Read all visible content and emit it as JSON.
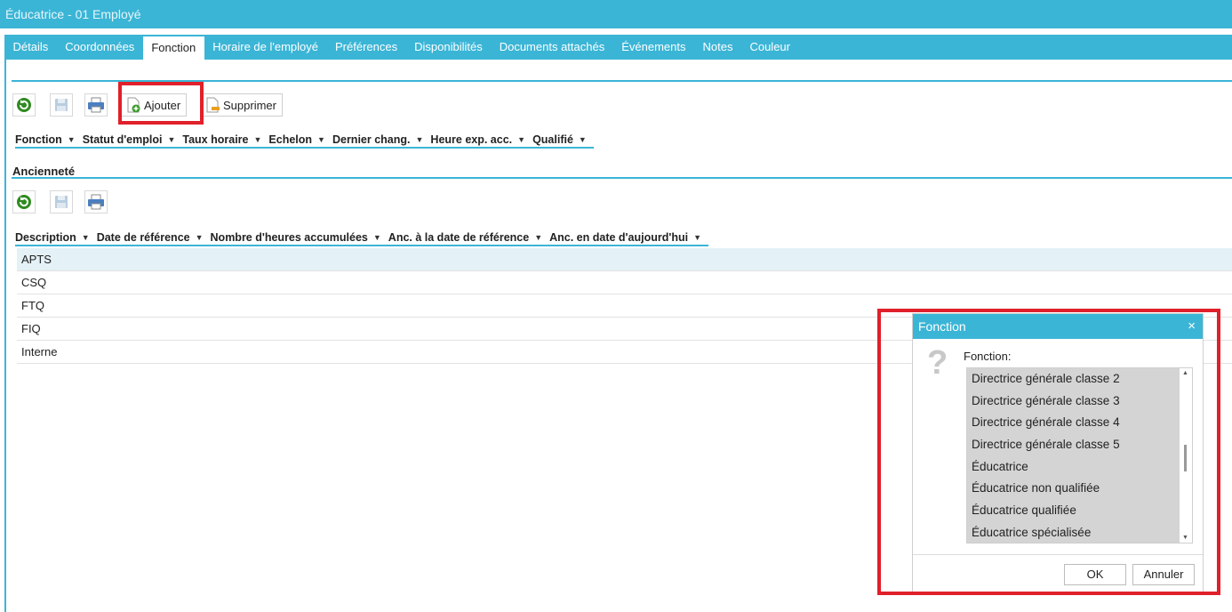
{
  "window": {
    "title": "Éducatrice - 01 Employé"
  },
  "tabs": [
    {
      "label": "Détails"
    },
    {
      "label": "Coordonnées"
    },
    {
      "label": "Fonction",
      "active": true
    },
    {
      "label": "Horaire de l'employé"
    },
    {
      "label": "Préférences"
    },
    {
      "label": "Disponibilités"
    },
    {
      "label": "Documents attachés"
    },
    {
      "label": "Événements"
    },
    {
      "label": "Notes"
    },
    {
      "label": "Couleur"
    }
  ],
  "toolbar": {
    "add_label": "Ajouter",
    "delete_label": "Supprimer",
    "icons": [
      "refresh-icon",
      "save-icon",
      "print-icon",
      "add-document-icon",
      "delete-document-icon"
    ]
  },
  "fonction_grid": {
    "columns": [
      "Fonction",
      "Statut d'emploi",
      "Taux horaire",
      "Echelon",
      "Dernier chang.",
      "Heure exp. acc.",
      "Qualifié"
    ]
  },
  "anciennete": {
    "title": "Ancienneté",
    "columns": [
      "Description",
      "Date de référence",
      "Nombre d'heures accumulées",
      "Anc. à la date de référence",
      "Anc. en date d'aujourd'hui"
    ],
    "rows": [
      "APTS",
      "CSQ",
      "FTQ",
      "FIQ",
      "Interne"
    ]
  },
  "dialog": {
    "title": "Fonction",
    "close_glyph": "×",
    "question_glyph": "?",
    "label": "Fonction:",
    "options": [
      "Directrice générale classe 2",
      "Directrice générale classe 3",
      "Directrice générale classe 4",
      "Directrice générale classe 5",
      "Éducatrice",
      "Éducatrice non qualifiée",
      "Éducatrice qualifiée",
      "Éducatrice spécialisée"
    ],
    "ok_label": "OK",
    "cancel_label": "Annuler"
  },
  "colors": {
    "accent": "#3bb5d6",
    "highlight": "#e0202a",
    "list_bg": "#d4d4d4",
    "selected_row": "#e4f1f6"
  }
}
